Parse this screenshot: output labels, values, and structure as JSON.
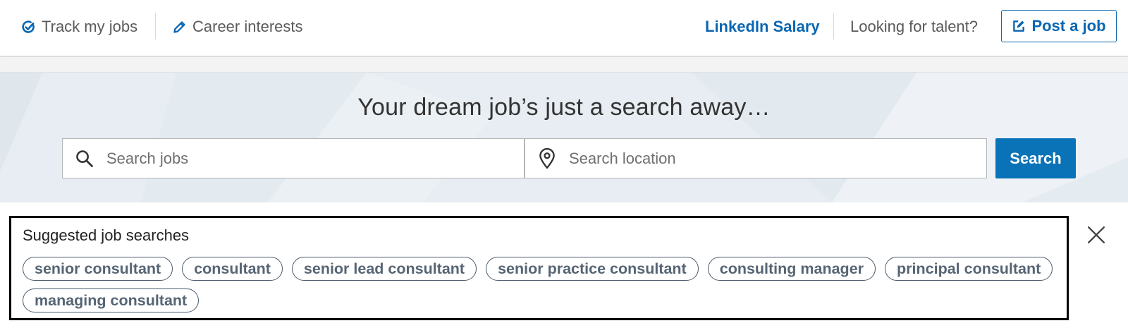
{
  "nav": {
    "track_jobs": "Track my jobs",
    "career_interests": "Career interests",
    "salary": "LinkedIn Salary",
    "looking_for_talent": "Looking for talent?",
    "post_job": "Post a job",
    "icons": {
      "track": "check-circle-icon",
      "career": "pencil-icon",
      "post": "edit-square-icon"
    }
  },
  "hero": {
    "title": "Your dream job’s just a search away…",
    "jobs_placeholder": "Search jobs",
    "location_placeholder": "Search location",
    "search_label": "Search",
    "icons": {
      "jobs": "search-icon",
      "location": "location-pin-icon"
    }
  },
  "suggested": {
    "title": "Suggested job searches",
    "pills": [
      "senior consultant",
      "consultant",
      "senior lead consultant",
      "senior practice consultant",
      "consulting manager",
      "principal consultant",
      "managing consultant"
    ],
    "close_icon": "close-icon"
  },
  "colors": {
    "brand_blue": "#0a66b2",
    "search_button": "#0a73b7",
    "hero_background": "#e7edf2",
    "pill_text": "#566573"
  }
}
